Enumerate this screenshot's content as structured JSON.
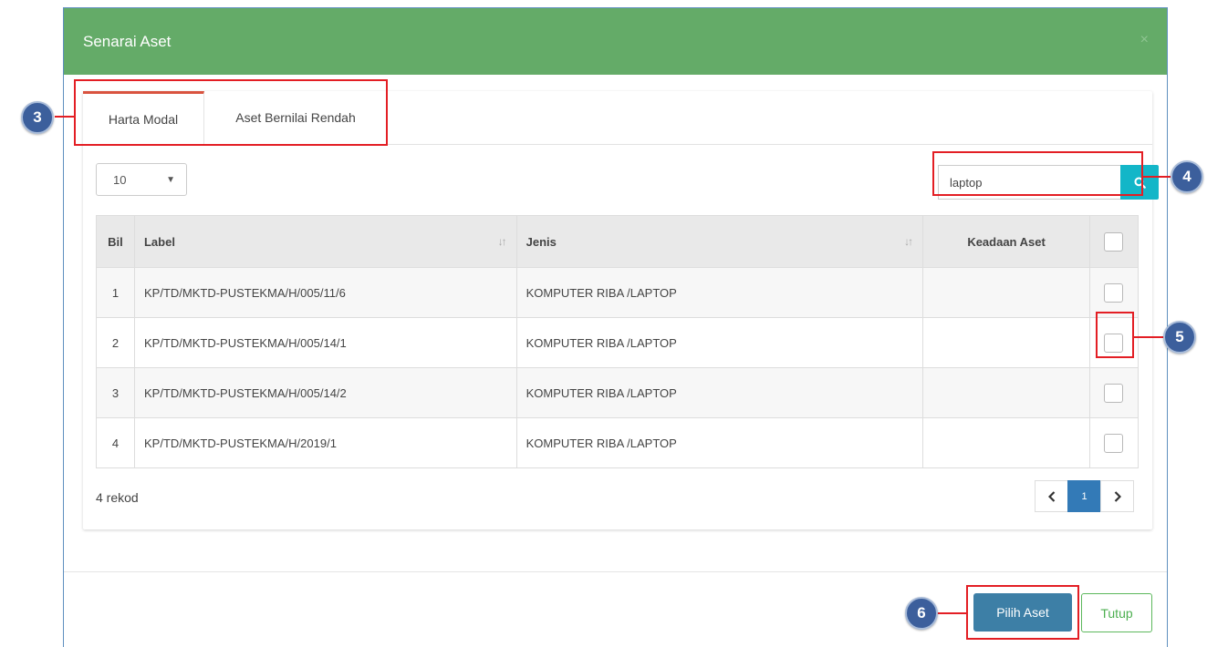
{
  "modal": {
    "title": "Senarai Aset",
    "close_symbol": "×"
  },
  "tabs": [
    {
      "label": "Harta Modal",
      "active": true
    },
    {
      "label": "Aset Bernilai Rendah",
      "active": false
    }
  ],
  "page_length": {
    "value": "10",
    "arrow": "▼"
  },
  "search": {
    "value": "laptop",
    "icon": "search-icon"
  },
  "table": {
    "headers": {
      "bil": "Bil",
      "label": "Label",
      "jenis": "Jenis",
      "keadaan": "Keadaan Aset"
    },
    "rows": [
      {
        "bil": "1",
        "label": "KP/TD/MKTD-PUSTEKMA/H/005/11/6",
        "jenis": "KOMPUTER RIBA /LAPTOP",
        "keadaan": ""
      },
      {
        "bil": "2",
        "label": "KP/TD/MKTD-PUSTEKMA/H/005/14/1",
        "jenis": "KOMPUTER RIBA /LAPTOP",
        "keadaan": ""
      },
      {
        "bil": "3",
        "label": "KP/TD/MKTD-PUSTEKMA/H/005/14/2",
        "jenis": "KOMPUTER RIBA /LAPTOP",
        "keadaan": ""
      },
      {
        "bil": "4",
        "label": "KP/TD/MKTD-PUSTEKMA/H/2019/1",
        "jenis": "KOMPUTER RIBA /LAPTOP",
        "keadaan": ""
      }
    ]
  },
  "footer_info": "4 rekod",
  "pagination": {
    "prev": "‹",
    "current": "1",
    "next": "›"
  },
  "buttons": {
    "pilih": "Pilih Aset",
    "tutup": "Tutup"
  },
  "annotations": {
    "tabs": "3",
    "search": "4",
    "checkbox": "5",
    "pilih": "6"
  },
  "colors": {
    "header": "#64ab68",
    "tab_accent": "#d9533f",
    "search_button": "#13b6c8",
    "primary_button": "#3d7fa6",
    "annotation": "#e31e24",
    "badge": "#3c5f9c"
  }
}
